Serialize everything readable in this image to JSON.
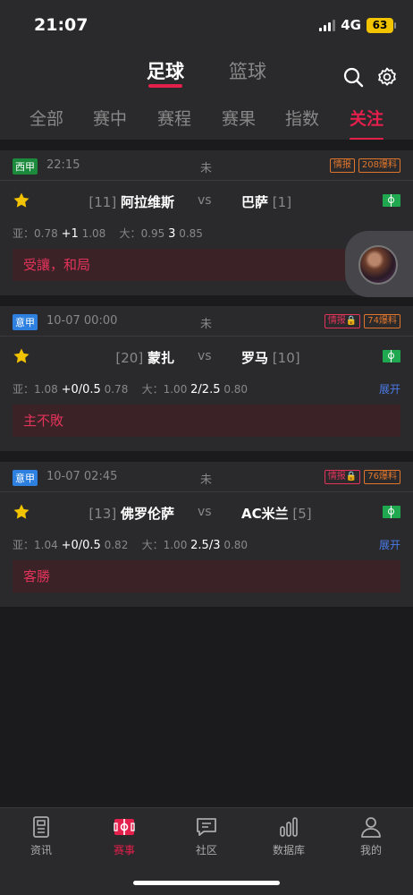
{
  "status_bar": {
    "time": "21:07",
    "network": "4G",
    "battery": "63"
  },
  "header": {
    "sport_tabs": [
      {
        "label": "足球",
        "active": true
      },
      {
        "label": "篮球",
        "active": false
      }
    ],
    "icons": [
      "search-icon",
      "gear-icon"
    ],
    "filter_tabs": [
      {
        "label": "全部",
        "active": false
      },
      {
        "label": "赛中",
        "active": false
      },
      {
        "label": "赛程",
        "active": false
      },
      {
        "label": "赛果",
        "active": false
      },
      {
        "label": "指数",
        "active": false
      },
      {
        "label": "关注",
        "active": true
      }
    ]
  },
  "matches": [
    {
      "league": "西甲",
      "league_color": "#1c8a3c",
      "time": "22:15",
      "status": "未",
      "tags": [
        "情报",
        "208爆料"
      ],
      "home_rank": "[11]",
      "home": "阿拉维斯",
      "vs": "vs",
      "away": "巴萨",
      "away_rank": "[1]",
      "odds": {
        "asia_label": "亚：",
        "asia_home": "0.78",
        "asia_line": "+1",
        "asia_away": "1.08",
        "big_label": "大：",
        "big_over": "0.95",
        "big_line": "3",
        "big_under": "0.85"
      },
      "expand": "",
      "prediction": "受讓，和局"
    },
    {
      "league": "意甲",
      "league_color": "#2d7fe0",
      "time": "10-07 00:00",
      "status": "未",
      "tags": [
        "情报🔒",
        "74爆料"
      ],
      "home_rank": "[20]",
      "home": "蒙扎",
      "vs": "vs",
      "away": "罗马",
      "away_rank": "[10]",
      "odds": {
        "asia_label": "亚：",
        "asia_home": "1.08",
        "asia_line": "+0/0.5",
        "asia_away": "0.78",
        "big_label": "大：",
        "big_over": "1.00",
        "big_line": "2/2.5",
        "big_under": "0.80"
      },
      "expand": "展开",
      "prediction": "主不敗"
    },
    {
      "league": "意甲",
      "league_color": "#2d7fe0",
      "time": "10-07 02:45",
      "status": "未",
      "tags": [
        "情报🔒",
        "76爆料"
      ],
      "home_rank": "[13]",
      "home": "佛罗伦萨",
      "vs": "vs",
      "away": "AC米兰",
      "away_rank": "[5]",
      "odds": {
        "asia_label": "亚：",
        "asia_home": "1.04",
        "asia_line": "+0/0.5",
        "asia_away": "0.82",
        "big_label": "大：",
        "big_over": "1.00",
        "big_line": "2.5/3",
        "big_under": "0.80"
      },
      "expand": "展开",
      "prediction": "客勝"
    }
  ],
  "tabbar": [
    {
      "label": "资讯",
      "icon": "news-icon",
      "active": false
    },
    {
      "label": "赛事",
      "icon": "match-icon",
      "active": true
    },
    {
      "label": "社区",
      "icon": "chat-icon",
      "active": false
    },
    {
      "label": "数据库",
      "icon": "chart-icon",
      "active": false
    },
    {
      "label": "我的",
      "icon": "profile-icon",
      "active": false
    }
  ],
  "colors": {
    "accent": "#e31f4b",
    "bg": "#1b1b1d",
    "card": "#2a2a2c"
  }
}
